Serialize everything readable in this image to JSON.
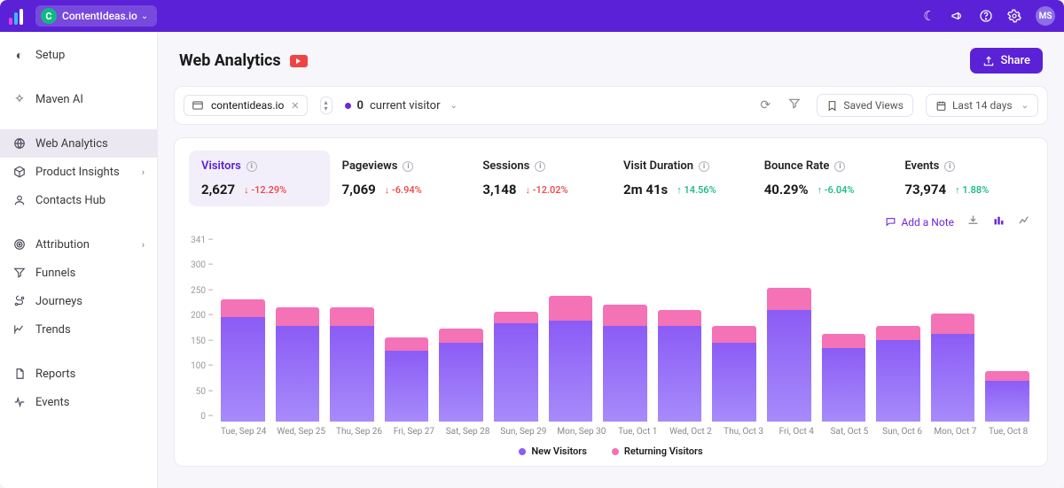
{
  "brand": {
    "app_name": "ContentIdeas.io",
    "avatar": "MS"
  },
  "sidebar": {
    "setup": "Setup",
    "maven": "Maven AI",
    "web_analytics": "Web Analytics",
    "product_insights": "Product Insights",
    "contacts": "Contacts Hub",
    "attribution": "Attribution",
    "funnels": "Funnels",
    "journeys": "Journeys",
    "trends": "Trends",
    "reports": "Reports",
    "events": "Events"
  },
  "page": {
    "title": "Web Analytics",
    "share": "Share"
  },
  "filters": {
    "domain": "contentideas.io",
    "live_count": "0",
    "live_label": "current visitor",
    "saved_views": "Saved Views",
    "range": "Last 14 days"
  },
  "kpis": [
    {
      "label": "Visitors",
      "value": "2,627",
      "delta": "-12.29%",
      "dir": "down"
    },
    {
      "label": "Pageviews",
      "value": "7,069",
      "delta": "-6.94%",
      "dir": "down"
    },
    {
      "label": "Sessions",
      "value": "3,148",
      "delta": "-12.02%",
      "dir": "down"
    },
    {
      "label": "Visit Duration",
      "value": "2m 41s",
      "delta": "14.56%",
      "dir": "up"
    },
    {
      "label": "Bounce Rate",
      "value": "40.29%",
      "delta": "-6.04%",
      "dir": "up"
    },
    {
      "label": "Events",
      "value": "73,974",
      "delta": "1.88%",
      "dir": "up"
    }
  ],
  "chart_tools": {
    "add_note": "Add a Note"
  },
  "legend": {
    "new": "New Visitors",
    "returning": "Returning Visitors"
  },
  "chart_data": {
    "type": "bar",
    "ylabel": "",
    "ylim": [
      0,
      341
    ],
    "yticks": [
      341,
      300,
      250,
      200,
      150,
      100,
      50,
      0
    ],
    "categories": [
      "Tue, Sep 24",
      "Wed, Sep 25",
      "Thu, Sep 26",
      "Fri, Sep 27",
      "Sat, Sep 28",
      "Sun, Sep 29",
      "Mon, Sep 30",
      "Tue, Oct 1",
      "Wed, Oct 2",
      "Thu, Oct 3",
      "Fri, Oct 4",
      "Sat, Oct 5",
      "Sun, Oct 6",
      "Mon, Oct 7",
      "Tue, Oct 8"
    ],
    "series": [
      {
        "name": "New Visitors",
        "values": [
          192,
          175,
          175,
          130,
          145,
          180,
          185,
          175,
          175,
          145,
          205,
          135,
          150,
          160,
          75
        ]
      },
      {
        "name": "Returning Visitors",
        "values": [
          32,
          35,
          35,
          25,
          25,
          22,
          45,
          40,
          30,
          30,
          40,
          25,
          25,
          38,
          18
        ]
      }
    ]
  }
}
